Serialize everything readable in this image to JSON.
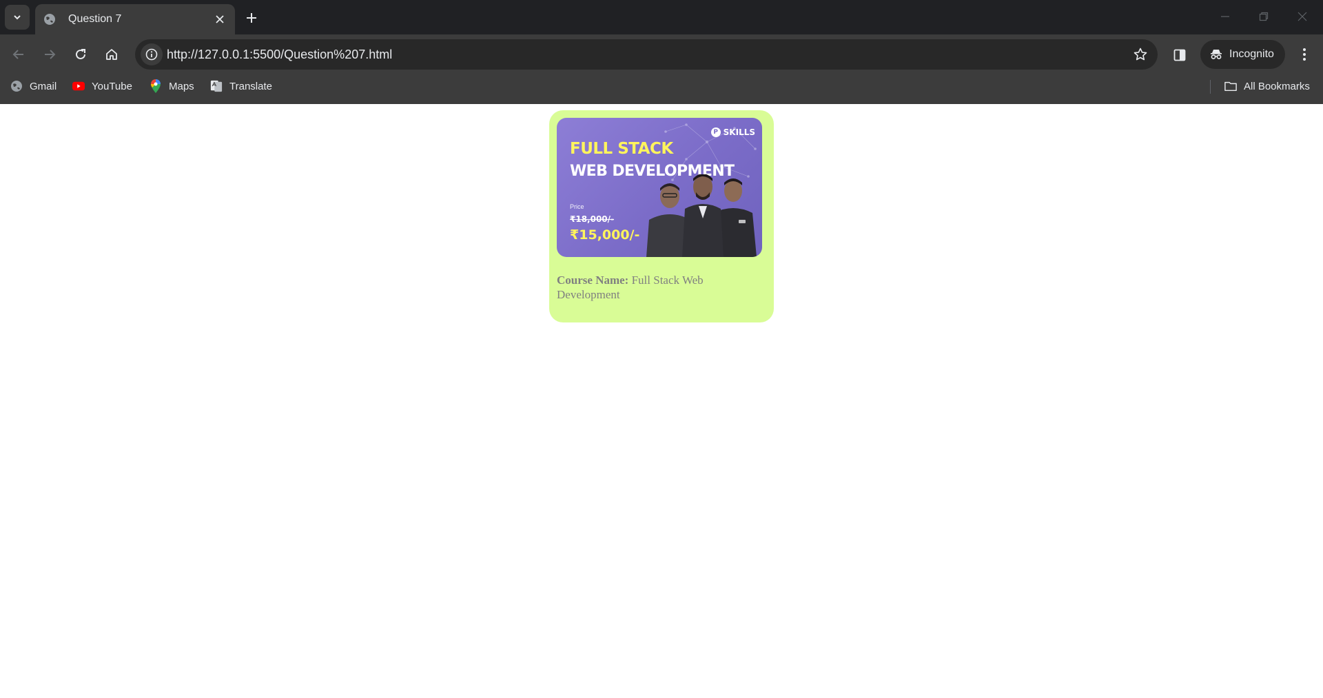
{
  "browser": {
    "tab_title": "Question 7",
    "url": "http://127.0.0.1:5500/Question%207.html",
    "profile_label": "Incognito",
    "bookmarks": [
      {
        "label": "Gmail",
        "icon": "globe-icon"
      },
      {
        "label": "YouTube",
        "icon": "youtube-icon"
      },
      {
        "label": "Maps",
        "icon": "maps-pin-icon"
      },
      {
        "label": "Translate",
        "icon": "translate-icon"
      }
    ],
    "all_bookmarks_label": "All Bookmarks"
  },
  "card": {
    "banner": {
      "logo_text": "SKILLS",
      "title_line1": "FULL STACK",
      "title_line2": "WEB DEVELOPMENT",
      "price_label": "Price",
      "old_price": "₹18,000/-",
      "new_price": "₹15,000/-"
    },
    "course_label": "Course Name:",
    "course_name": "Full Stack Web Development"
  },
  "colors": {
    "card_bg": "#d9fc96",
    "banner_bg": "#7b6cc8",
    "banner_accent": "#fff45c",
    "text_muted": "#808080"
  }
}
